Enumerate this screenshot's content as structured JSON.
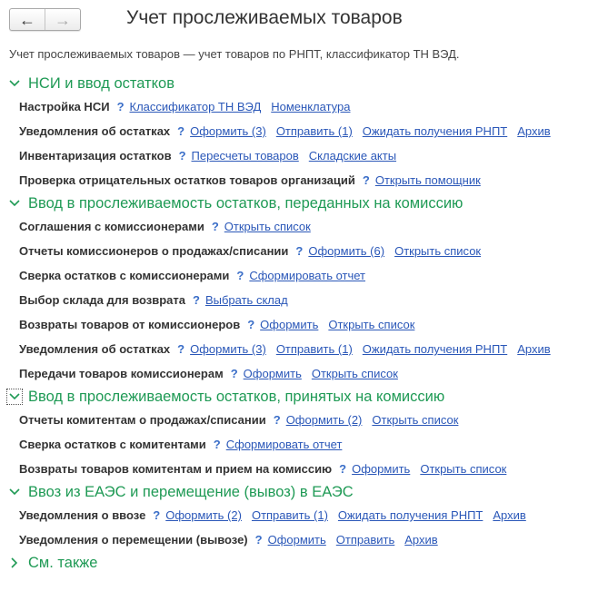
{
  "nav": {
    "back_glyph": "←",
    "forward_glyph": "→",
    "back_icon": "arrow-left-icon",
    "forward_icon": "arrow-right-icon"
  },
  "title": "Учет прослеживаемых товаров",
  "description": "Учет прослеживаемых товаров — учет товаров по РНПТ, классификатор ТН ВЭД.",
  "help_glyph": "?",
  "colors": {
    "section": "#1f9a55",
    "link": "#2a57b8",
    "help": "#3a6ec8",
    "label": "#333333"
  },
  "sections": [
    {
      "title": "НСИ и ввод остатков",
      "expanded": true,
      "rows": [
        {
          "label": "Настройка НСИ",
          "links": [
            "Классификатор ТН ВЭД",
            "Номенклатура"
          ]
        },
        {
          "label": "Уведомления об остатках",
          "links": [
            "Оформить (3)",
            "Отправить (1)",
            "Ожидать получения РНПТ",
            "Архив"
          ]
        },
        {
          "label": "Инвентаризация остатков",
          "links": [
            "Пересчеты товаров",
            "Складские акты"
          ]
        },
        {
          "label": "Проверка отрицательных остатков товаров организаций",
          "links": [
            "Открыть помощник"
          ]
        }
      ]
    },
    {
      "title": "Ввод в прослеживаемость остатков, переданных на комиссию",
      "expanded": true,
      "rows": [
        {
          "label": "Соглашения с комиссионерами",
          "links": [
            "Открыть список"
          ]
        },
        {
          "label": "Отчеты комиссионеров о продажах/списании",
          "links": [
            "Оформить (6)",
            "Открыть список"
          ]
        },
        {
          "label": "Сверка остатков с комиссионерами",
          "links": [
            "Сформировать отчет"
          ]
        },
        {
          "label": "Выбор склада для возврата",
          "links": [
            "Выбрать склад"
          ]
        },
        {
          "label": "Возвраты товаров от комиссионеров",
          "links": [
            "Оформить",
            "Открыть список"
          ]
        },
        {
          "label": "Уведомления об остатках",
          "links": [
            "Оформить (3)",
            "Отправить (1)",
            "Ожидать получения РНПТ",
            "Архив"
          ]
        },
        {
          "label": "Передачи товаров комиссионерам",
          "links": [
            "Оформить",
            "Открыть список"
          ]
        }
      ]
    },
    {
      "title": "Ввод в прослеживаемость остатков, принятых на комиссию",
      "expanded": true,
      "focused": true,
      "rows": [
        {
          "label": "Отчеты комитентам о продажах/списании",
          "links": [
            "Оформить (2)",
            "Открыть список"
          ]
        },
        {
          "label": "Сверка остатков с комитентами",
          "links": [
            "Сформировать отчет"
          ]
        },
        {
          "label": "Возвраты товаров комитентам и прием на комиссию",
          "links": [
            "Оформить",
            "Открыть список"
          ]
        }
      ]
    },
    {
      "title": "Ввоз из ЕАЭС и перемещение (вывоз) в ЕАЭС",
      "expanded": true,
      "rows": [
        {
          "label": "Уведомления о ввозе",
          "links": [
            "Оформить (2)",
            "Отправить (1)",
            "Ожидать получения РНПТ",
            "Архив"
          ]
        },
        {
          "label": "Уведомления о перемещении (вывозе)",
          "links": [
            "Оформить",
            "Отправить",
            "Архив"
          ]
        }
      ]
    },
    {
      "title": "См. также",
      "expanded": false,
      "rows": []
    }
  ]
}
